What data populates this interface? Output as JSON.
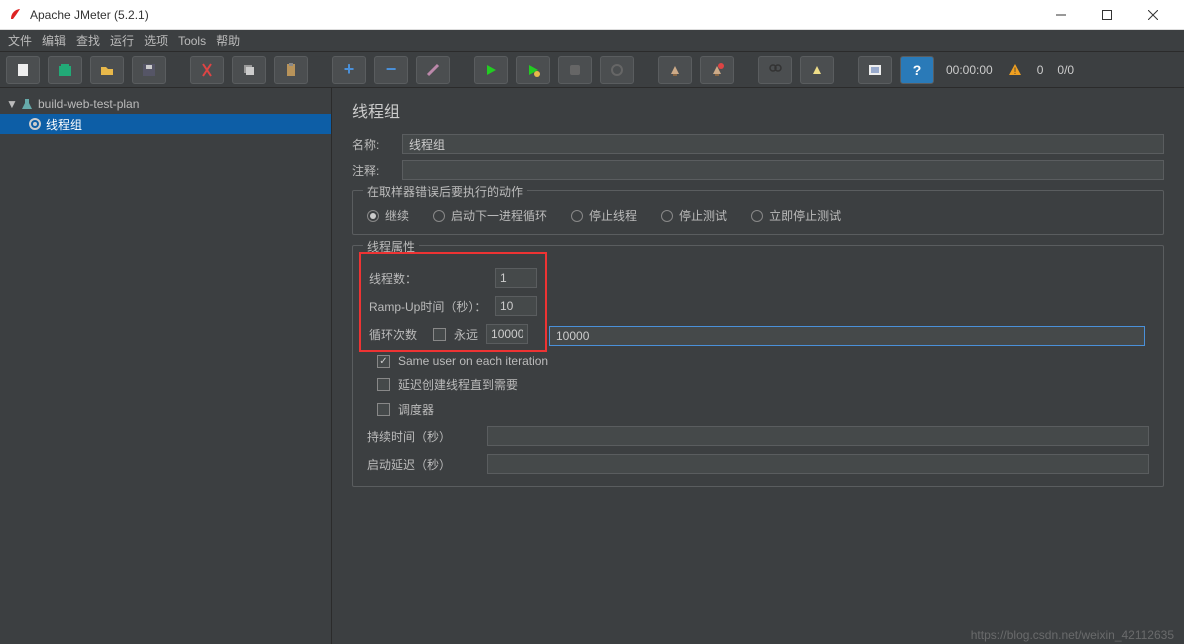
{
  "window": {
    "title": "Apache JMeter (5.2.1)",
    "timer": "00:00:00",
    "counter_left": "0",
    "counter_right": "0/0"
  },
  "menu": [
    "文件",
    "编辑",
    "查找",
    "运行",
    "选项",
    "Tools",
    "帮助"
  ],
  "tree": {
    "root_label": "build-web-test-plan",
    "child_label": "线程组"
  },
  "page": {
    "title": "线程组",
    "name_label": "名称:",
    "name_value": "线程组",
    "comment_label": "注释:",
    "comment_value": "",
    "error_legend": "在取样器错误后要执行的动作",
    "radios": {
      "continue": "继续",
      "start_next": "启动下一进程循环",
      "stop_thread": "停止线程",
      "stop_test": "停止测试",
      "stop_now": "立即停止测试"
    },
    "props_legend": "线程属性",
    "threads_label": "线程数：",
    "threads_value": "1",
    "rampup_label": "Ramp-Up时间（秒）：",
    "rampup_value": "10",
    "loop_label": "循环次数",
    "forever_label": "永远",
    "loop_value": "10000",
    "same_user": "Same user on each iteration",
    "delay_create": "延迟创建线程直到需要",
    "scheduler": "调度器",
    "duration_label": "持续时间（秒）",
    "startup_label": "启动延迟（秒）"
  },
  "watermark": "https://blog.csdn.net/weixin_42112635"
}
